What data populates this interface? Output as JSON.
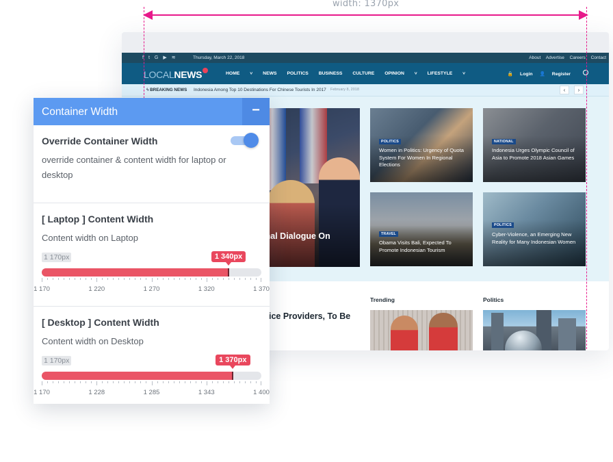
{
  "annotation": {
    "width_label": "width: 1370px"
  },
  "website": {
    "topbar": {
      "social_icons": [
        "facebook-icon",
        "twitter-icon",
        "google-plus-icon",
        "youtube-icon",
        "rss-icon"
      ],
      "date": "Thursday, March 22, 2018",
      "links": [
        "About",
        "Advertise",
        "Careers",
        "Contact"
      ]
    },
    "logo": {
      "part1": "LOCAL",
      "part2": "NEWS"
    },
    "menu": [
      "HOME",
      "NEWS",
      "POLITICS",
      "BUSINESS",
      "CULTURE",
      "OPINION",
      "LIFESTYLE"
    ],
    "auth": {
      "login": "Login",
      "register": "Register"
    },
    "breaking": {
      "label": "BREAKING NEWS",
      "headline": "Indonesia Among Top 10 Destinations For Chinese Tourists In 2017",
      "date": "February 8, 2018"
    },
    "hero_title": "onal Dialogue On",
    "cards": [
      {
        "category": "POLITICS",
        "title": "Women in Politics: Urgency of Quota System For Women In Regional Elections"
      },
      {
        "category": "NATIONAL",
        "title": "Indonesia Urges Olympic Council of Asia to Promote 2018 Asian Games"
      },
      {
        "category": "TRAVEL",
        "title": "Obama Visits Bali, Expected To Promote Indonesian Tourism"
      },
      {
        "category": "POLITICS",
        "title": "Cyber-Violence, an Emerging New Reality for Many Indonesian Women"
      }
    ],
    "lower_headline": "ice Providers, To Be",
    "sections": {
      "trending": "Trending",
      "politics": "Politics"
    }
  },
  "panel": {
    "title": "Container Width",
    "collapse_symbol": "−",
    "override": {
      "title": "Override Container Width",
      "description": "override container & content width for laptop or desktop",
      "enabled": true
    },
    "laptop": {
      "title": "[ Laptop ] Content Width",
      "description": "Content width on Laptop",
      "min_label": "1 170px",
      "value_label": "1 340px",
      "min": 1170,
      "max": 1370,
      "value": 1340,
      "tick_labels": [
        "1 170",
        "1 220",
        "1 270",
        "1 320",
        "1 370"
      ]
    },
    "desktop": {
      "title": "[ Desktop ] Content Width",
      "description": "Content width on Desktop",
      "min_label": "1 170px",
      "value_label": "1 370px",
      "min": 1170,
      "max": 1400,
      "value": 1370,
      "tick_labels": [
        "1 170",
        "1 228",
        "1 285",
        "1 343",
        "1 400"
      ]
    }
  }
}
